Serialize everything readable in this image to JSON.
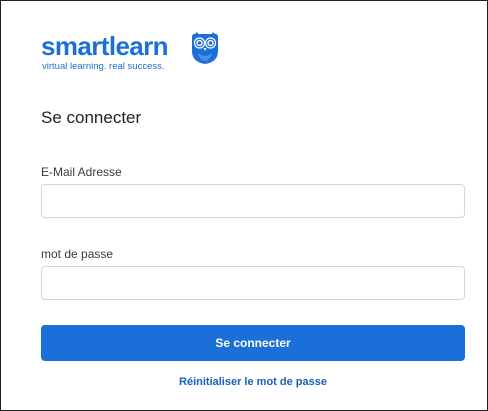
{
  "brand": {
    "name": "smartlearn",
    "tagline": "virtual learning. real success.",
    "color": "#1d6fd8",
    "icon": "owl-logo-icon"
  },
  "page": {
    "title": "Se connecter"
  },
  "form": {
    "email": {
      "label": "E-Mail Adresse",
      "value": "",
      "placeholder": ""
    },
    "password": {
      "label": "mot de passe",
      "value": "",
      "placeholder": ""
    },
    "submit_label": "Se connecter",
    "submit_color": "#1a6fd9",
    "reset_link_label": "Réinitialiser le mot de passe"
  }
}
